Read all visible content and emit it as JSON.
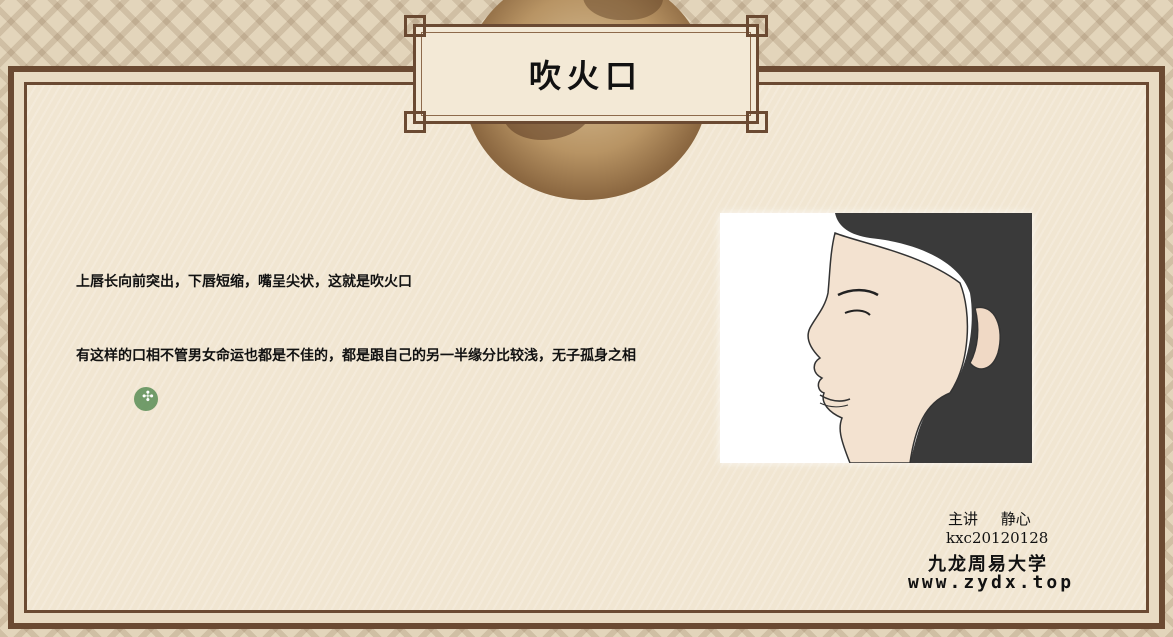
{
  "slide": {
    "title": "吹火口",
    "paragraphs": [
      "上唇长向前突出，下唇短缩，嘴呈尖状，这就是吹火口",
      "有这样的口相不管男女命运也都是不佳的，都是跟自己的另一半缘分比较浅，无子孤身之相"
    ]
  },
  "credits": {
    "lecturer": "主讲 静心",
    "id": "kxc20120128",
    "org": "九龙周易大学",
    "site": "www.zydx.top"
  },
  "colors": {
    "frame": "#6b4a32",
    "paper": "#f1e6d2",
    "text": "#111111"
  },
  "icons": {
    "cursor": "cursor-icon"
  }
}
